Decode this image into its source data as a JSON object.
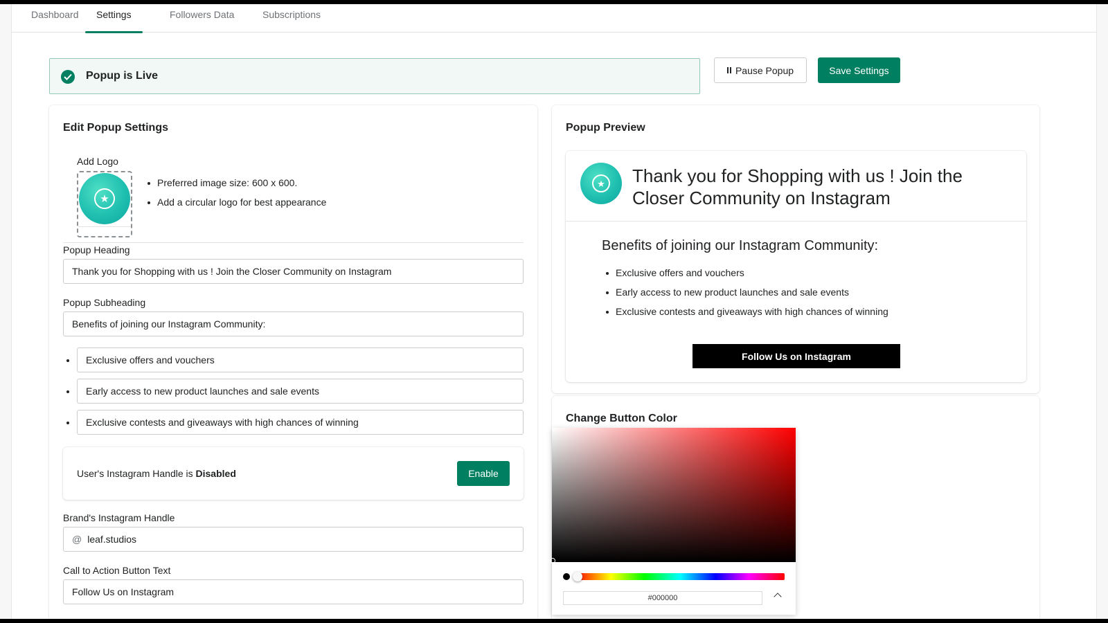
{
  "tabs": [
    {
      "label": "Dashboard"
    },
    {
      "label": "Settings"
    },
    {
      "label": "Followers Data"
    },
    {
      "label": "Subscriptions"
    }
  ],
  "active_tab": "Settings",
  "status_banner": {
    "text": "Popup is Live"
  },
  "header_actions": {
    "pause_label": "Pause Popup",
    "save_label": "Save Settings"
  },
  "edit_card": {
    "title": "Edit Popup Settings",
    "logo": {
      "label": "Add Logo",
      "tips": [
        "Preferred image size: 600 x 600.",
        "Add a circular logo for best appearance"
      ]
    },
    "heading_label": "Popup Heading",
    "heading_value": "Thank you for Shopping with us ! Join the Closer Community on Instagram",
    "subheading_label": "Popup Subheading",
    "subheading_value": "Benefits of joining our Instagram Community:",
    "benefits": [
      "Exclusive offers and vouchers",
      "Early access to new product launches and sale events",
      "Exclusive contests and giveaways with high chances of winning"
    ],
    "user_handle": {
      "text_prefix": "User's Instagram Handle is",
      "status": "Disabled",
      "enable_label": "Enable"
    },
    "brand_handle_label": "Brand's Instagram Handle",
    "brand_handle_prefix": "@",
    "brand_handle_value": "leaf.studios",
    "cta_label": "Call to Action Button Text",
    "cta_value": "Follow Us on Instagram"
  },
  "preview_card": {
    "title": "Popup Preview",
    "heading": "Thank you for Shopping with us ! Join the Closer Community on Instagram",
    "subheading": "Benefits of joining our Instagram Community:",
    "benefits": [
      "Exclusive offers and vouchers",
      "Early access to new product launches and sale events",
      "Exclusive contests and giveaways with high chances of winning"
    ],
    "cta": "Follow Us on Instagram"
  },
  "color_card": {
    "title": "Change Button Color",
    "hex_value": "#000000",
    "hue_color": "#ff0000",
    "selected_color": "#000000"
  },
  "colors": {
    "primary": "#008060",
    "banner_bg": "#f1f8f5",
    "banner_border": "#95c9b4",
    "cta_bg": "#000000"
  },
  "icons": {
    "status": "check-circle-icon",
    "pause": "pause-icon",
    "logo": "star-badge-icon",
    "toggle": "chevron-up-icon"
  }
}
